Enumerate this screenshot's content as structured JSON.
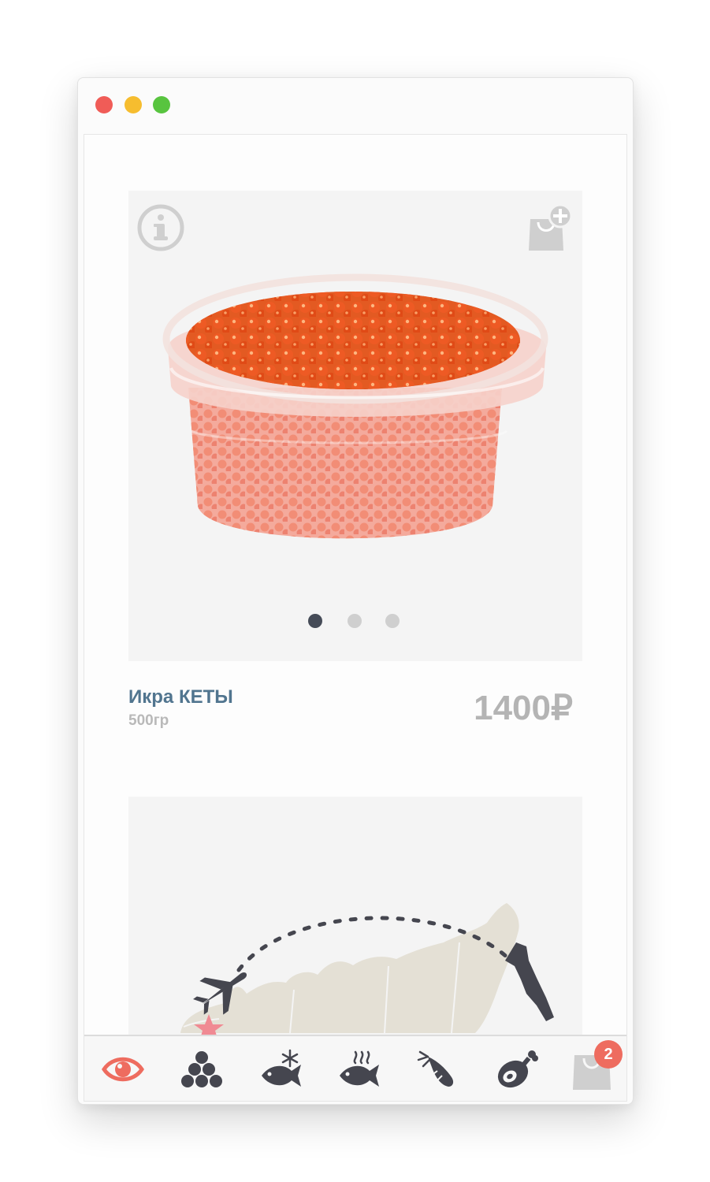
{
  "window_controls": {
    "close_color": "#f05c57",
    "minimize_color": "#f6bd2f",
    "maximize_color": "#58c43f"
  },
  "product": {
    "name": "Икра КЕТЫ",
    "weight": "500гр",
    "price": "1400₽",
    "image": "red-caviar-tub",
    "info_icon": "info-icon",
    "add_to_cart_icon": "add-to-cart-icon",
    "slides": {
      "count": 3,
      "active_index": 0
    }
  },
  "map": {
    "icons": [
      "airplane-icon",
      "destination-marker",
      "origin-star"
    ]
  },
  "bottom_nav": {
    "items": [
      {
        "icon": "eye-icon",
        "active": true
      },
      {
        "icon": "caviar-icon",
        "active": false
      },
      {
        "icon": "frozen-fish-icon",
        "active": false
      },
      {
        "icon": "smoked-fish-icon",
        "active": false
      },
      {
        "icon": "shrimp-icon",
        "active": false
      },
      {
        "icon": "meat-leg-icon",
        "active": false
      },
      {
        "icon": "cart-icon",
        "active": false
      }
    ],
    "cart_count": "2"
  },
  "colors": {
    "accent": "#ee6c5f",
    "title": "#51758f",
    "muted": "#b4b4b4",
    "icon_dark": "#45464f",
    "dot_active": "#454b57",
    "dot_inactive": "#cfcfcf",
    "badge": "#ee6c5f"
  }
}
